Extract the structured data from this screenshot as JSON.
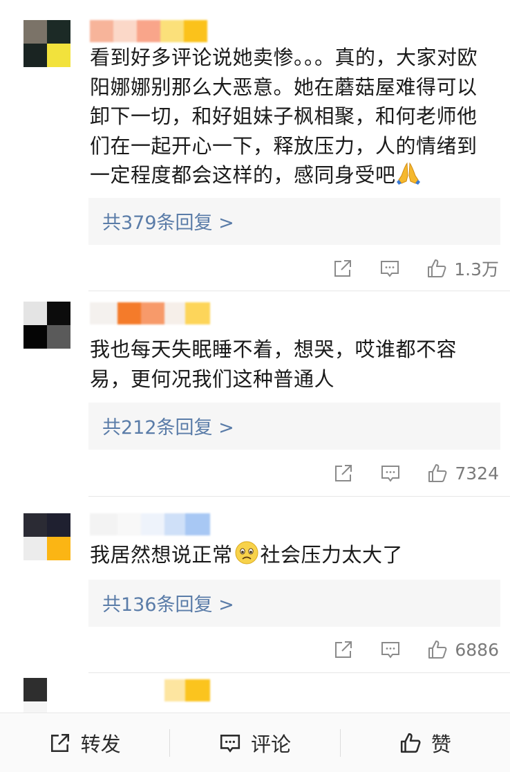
{
  "comments": [
    {
      "text": "看到好多评论说她卖惨。。。真的，大家对欧阳娜娜别那么大恶意。她在蘑菇屋难得可以卸下一切，和好姐妹子枫相聚，和何老师他们在一起开心一下，释放压力，人的情绪到一定程度都会这样的，感同身受吧",
      "emoji": "folded-hands",
      "replies_label": "共379条回复 >",
      "likes": "1.3万",
      "avatar_colors": [
        "#7b7368",
        "#1c2a26",
        "#1a2422",
        "#f2e23c"
      ],
      "name_colors": [
        "#f7b49a",
        "#fbd8c8",
        "#f9a58a",
        "#fbe07a",
        "#fbc21b"
      ]
    },
    {
      "text": "我也每天失眠睡不着，想哭，哎谁都不容易，更何况我们这种普通人",
      "replies_label": "共212条回复 >",
      "likes": "7324",
      "avatar_colors": [
        "#e4e4e4",
        "#0c0c0c",
        "#050505",
        "#5a5a5a"
      ],
      "name_colors": [
        "#f4f1ee",
        "#f47b2a",
        "#f79a6a",
        "#f6efe9",
        "#fdd55a"
      ]
    },
    {
      "text_before": "我居然想说正常",
      "emoji": "sad-face",
      "text_after": "社会压力太大了",
      "replies_label": "共136条回复 >",
      "likes": "6886",
      "avatar_colors": [
        "#2b2b34",
        "#1f2030",
        "#ececec",
        "#fbb514"
      ],
      "name_colors": [
        "#f3f3f3",
        "#f8f8f8",
        "#eef3fb",
        "#cfe0f8",
        "#a8c8f4"
      ]
    },
    {
      "avatar_colors": [
        "#2e2e2e",
        "#ffffff",
        "#f5f5f5",
        "#ffffff"
      ],
      "name_colors": [
        "#ffffff",
        "#ffffff",
        "#ffffff",
        "#fde5a0",
        "#fbc41e"
      ]
    }
  ],
  "bottom_bar": {
    "repost_label": "转发",
    "comment_label": "评论",
    "like_label": "赞"
  },
  "colors": {
    "reply_link": "#5a7ca8",
    "reply_bg": "#f6f6f6",
    "muted": "#7a7a7a"
  }
}
